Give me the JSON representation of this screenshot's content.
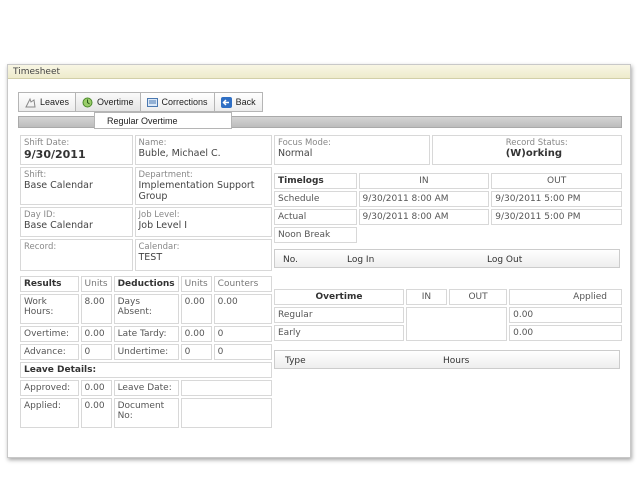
{
  "window": {
    "title": "Timesheet"
  },
  "toolbar": {
    "leaves": "Leaves",
    "overtime": "Overtime",
    "corrections": "Corrections",
    "back": "Back"
  },
  "dropdown": {
    "item": "Regular Overtime"
  },
  "info": {
    "shift_date_label": "Shift Date:",
    "shift_date": "9/30/2011",
    "name_label": "Name:",
    "name": "Buble, Michael C.",
    "shift_label": "Shift:",
    "shift": "Base Calendar",
    "department_label": "Department:",
    "department": "Implementation Support Group",
    "day_id_label": "Day ID:",
    "day_id": "Base Calendar",
    "job_level_label": "Job Level:",
    "job_level": "Job Level I",
    "record_label": "Record:",
    "calendar_label": "Calendar:",
    "calendar": "TEST"
  },
  "results": {
    "results_h": "Results",
    "units_h": "Units",
    "deductions_h": "Deductions",
    "units2_h": "Units",
    "counters_h": "Counters",
    "rows": [
      {
        "label": "Work Hours:",
        "units": "8.00",
        "ded": "Days Absent:",
        "dunits": "0.00",
        "counters": "0.00"
      },
      {
        "label": "Overtime:",
        "units": "0.00",
        "ded": "Late Tardy:",
        "dunits": "0.00",
        "counters": "0"
      },
      {
        "label": "Advance:",
        "units": "0",
        "ded": "Undertime:",
        "dunits": "0",
        "counters": "0"
      }
    ],
    "leave_details": "Leave Details:",
    "approved_label": "Approved:",
    "approved": "0.00",
    "leave_date_label": "Leave Date:",
    "applied_label": "Applied:",
    "applied": "0.00",
    "document_label": "Document No:"
  },
  "focus": {
    "focus_label": "Focus Mode:",
    "focus": "Normal",
    "status_label": "Record Status:",
    "status": "(W)orking"
  },
  "timelogs": {
    "heading": "Timelogs",
    "in_h": "IN",
    "out_h": "OUT",
    "schedule_label": "Schedule",
    "schedule_in": "9/30/2011 8:00 AM",
    "schedule_out": "9/30/2011 5:00 PM",
    "actual_label": "Actual",
    "actual_in": "9/30/2011 8:00 AM",
    "actual_out": "9/30/2011 5:00 PM",
    "noon_break": "Noon Break"
  },
  "loglist": {
    "no": "No.",
    "log_in": "Log In",
    "log_out": "Log Out"
  },
  "overtime": {
    "heading": "Overtime",
    "in_h": "IN",
    "out_h": "OUT",
    "applied_h": "Applied",
    "regular": "Regular",
    "regular_applied": "0.00",
    "early": "Early",
    "early_applied": "0.00"
  },
  "typelist": {
    "type": "Type",
    "hours": "Hours"
  }
}
